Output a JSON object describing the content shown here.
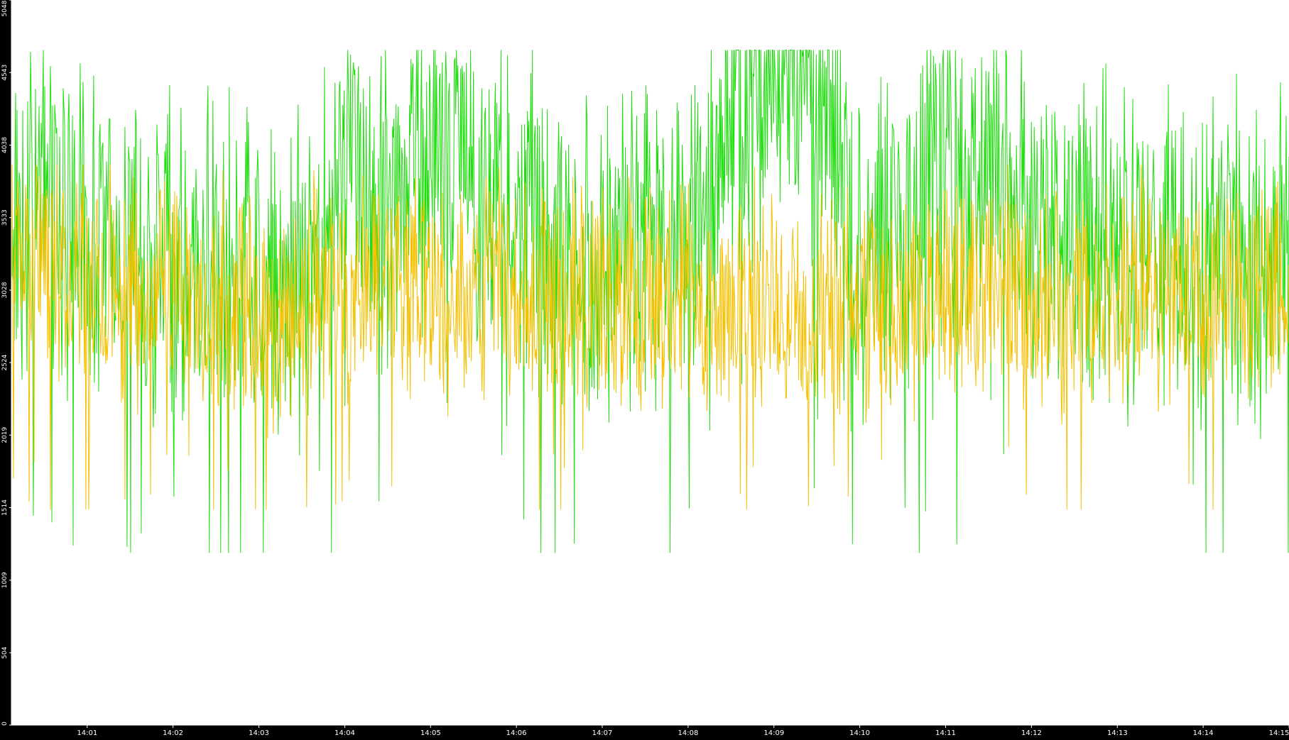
{
  "chart_data": {
    "type": "line",
    "title": "",
    "xlabel": "",
    "ylabel": "",
    "ylim": [
      0,
      5048
    ],
    "y_ticks": [
      0,
      504,
      1009,
      1514,
      2019,
      2524,
      3028,
      3533,
      4038,
      4543,
      5048
    ],
    "x_ticks": [
      "14:01",
      "14:02",
      "14:03",
      "14:04",
      "14:05",
      "14:06",
      "14:07",
      "14:08",
      "14:09",
      "14:10",
      "14:11",
      "14:12",
      "14:13",
      "14:14",
      "14:15"
    ],
    "x_range": [
      "14:00:07",
      "14:15:00"
    ],
    "grid": false,
    "legend": "none",
    "series": [
      {
        "color": "#22dd11",
        "x": [
          "14:00:07",
          "14:00:30",
          "14:01:00",
          "14:01:30",
          "14:02:00",
          "14:02:30",
          "14:03:00",
          "14:03:30",
          "14:03:50",
          "14:04:00",
          "14:04:10",
          "14:04:25",
          "14:04:40",
          "14:04:55",
          "14:05:05",
          "14:05:20",
          "14:05:35",
          "14:05:50",
          "14:06:00",
          "14:06:30",
          "14:07:00",
          "14:07:30",
          "14:07:55",
          "14:08:20",
          "14:08:35",
          "14:08:45",
          "14:08:55",
          "14:09:05",
          "14:09:15",
          "14:09:25",
          "14:09:35",
          "14:09:45",
          "14:10:00",
          "14:10:30",
          "14:10:40",
          "14:10:55",
          "14:11:10",
          "14:11:25",
          "14:11:40",
          "14:11:55",
          "14:12:10",
          "14:12:30",
          "14:13:00",
          "14:13:30",
          "14:14:00",
          "14:14:30",
          "14:15:00"
        ],
        "y": [
          3500,
          3700,
          3400,
          3300,
          3300,
          3200,
          3100,
          3150,
          3500,
          4100,
          4000,
          3600,
          3900,
          3850,
          3800,
          4050,
          3500,
          3950,
          3600,
          3300,
          3250,
          3300,
          3550,
          3900,
          4300,
          4400,
          4500,
          4650,
          4600,
          4300,
          4200,
          4100,
          3350,
          3300,
          3700,
          3800,
          3850,
          3900,
          3800,
          3500,
          3350,
          3300,
          3300,
          3350,
          3250,
          3300,
          3300
        ],
        "range": [
          1200,
          4700
        ]
      },
      {
        "color": "#f5c000",
        "x": [
          "14:00:07",
          "14:00:30",
          "14:01:00",
          "14:01:30",
          "14:02:00",
          "14:02:30",
          "14:03:00",
          "14:03:15",
          "14:03:30",
          "14:04:00",
          "14:04:30",
          "14:05:00",
          "14:05:30",
          "14:06:00",
          "14:06:30",
          "14:07:00",
          "14:07:30",
          "14:08:00",
          "14:08:30",
          "14:08:50",
          "14:09:10",
          "14:09:30",
          "14:10:00",
          "14:10:30",
          "14:11:00",
          "14:11:30",
          "14:12:00",
          "14:12:20",
          "14:12:40",
          "14:13:00",
          "14:13:30",
          "14:14:00",
          "14:14:30",
          "14:15:00"
        ],
        "y": [
          3200,
          3300,
          3150,
          3050,
          3000,
          2950,
          2900,
          2700,
          2950,
          3100,
          3100,
          3000,
          3000,
          3050,
          3000,
          3050,
          2950,
          3000,
          2950,
          3000,
          2850,
          2900,
          3000,
          2950,
          3050,
          3100,
          3000,
          2900,
          3000,
          3050,
          3050,
          3000,
          3050,
          3000
        ],
        "range": [
          1500,
          3900
        ]
      }
    ]
  }
}
